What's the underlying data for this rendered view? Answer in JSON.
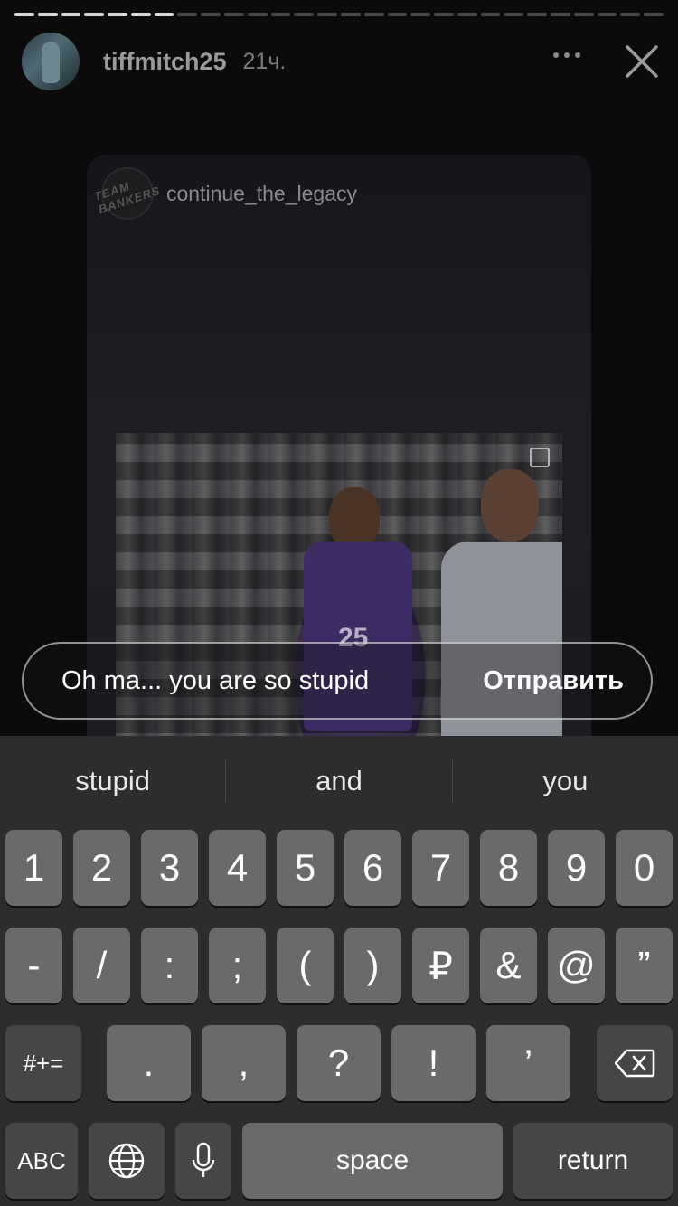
{
  "story": {
    "username": "tiffmitch25",
    "time_ago": "21ч.",
    "progress_done": 7,
    "progress_total": 28
  },
  "card": {
    "username": "continue_the_legacy",
    "logo_text": "TEAM BANKERS"
  },
  "photo": {
    "jersey_number": "25"
  },
  "reply": {
    "input_value": "Oh ma... you are so stupid",
    "send_label": "Отправить"
  },
  "keyboard": {
    "suggestions": [
      "stupid",
      "and",
      "you"
    ],
    "row1": [
      "1",
      "2",
      "3",
      "4",
      "5",
      "6",
      "7",
      "8",
      "9",
      "0"
    ],
    "row2": [
      "-",
      "/",
      ":",
      ";",
      "(",
      ")",
      "₽",
      "&",
      "@",
      "”"
    ],
    "row3": {
      "symbols_label": "#+=",
      "keys": [
        ".",
        ",",
        "?",
        "!",
        "’"
      ]
    },
    "row4": {
      "abc_label": "ABC",
      "space_label": "space",
      "return_label": "return"
    }
  },
  "colors": {
    "keyboard_bg": "#2d2d2f",
    "key": "#6a6a6c",
    "key_dark": "#464648"
  }
}
